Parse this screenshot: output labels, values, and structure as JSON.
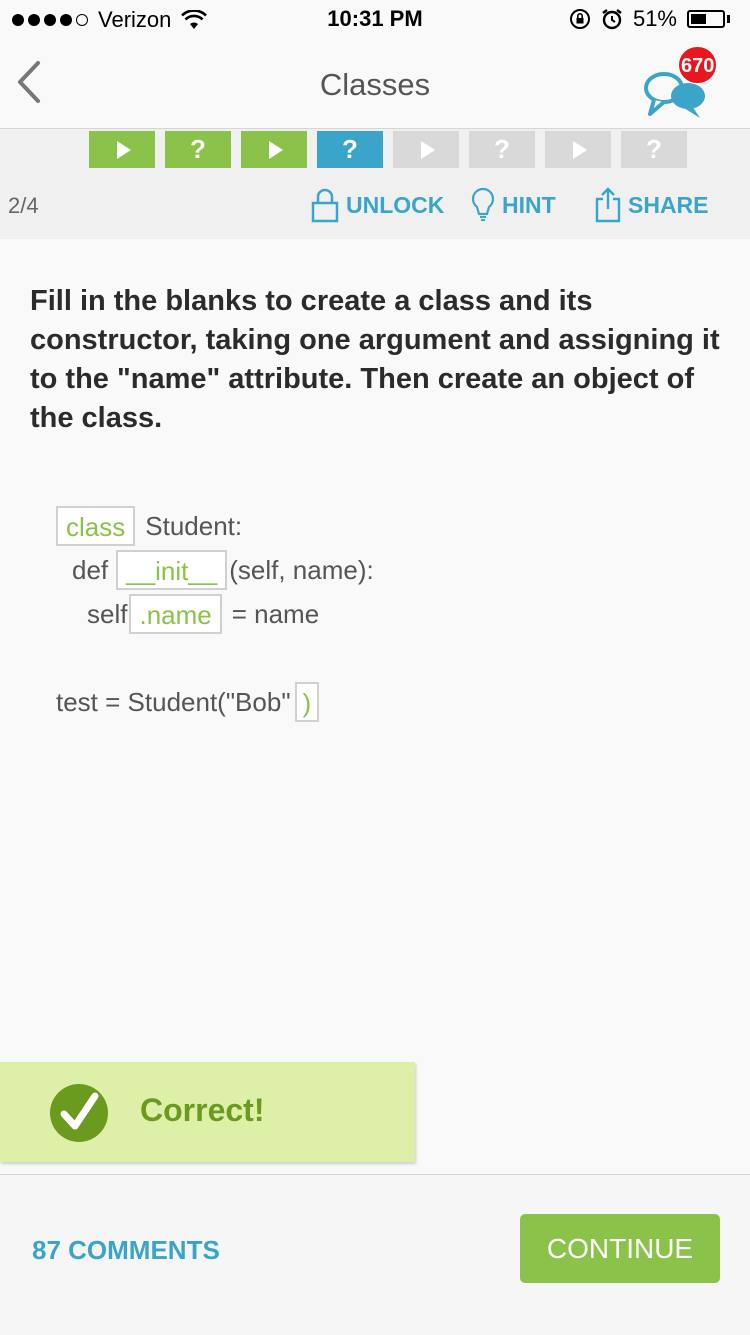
{
  "status_bar": {
    "carrier": "Verizon",
    "time": "10:31 PM",
    "battery": "51%",
    "battery_level": 0.51,
    "signal_bars_filled": 4,
    "signal_bars_total": 5
  },
  "header": {
    "title": "Classes",
    "chat_badge": "670"
  },
  "progress": {
    "steps": [
      {
        "kind": "play",
        "state": "done",
        "glyph": ""
      },
      {
        "kind": "quiz",
        "state": "done",
        "glyph": "?"
      },
      {
        "kind": "play",
        "state": "done",
        "glyph": ""
      },
      {
        "kind": "quiz",
        "state": "current",
        "glyph": "?"
      },
      {
        "kind": "play",
        "state": "future",
        "glyph": ""
      },
      {
        "kind": "quiz",
        "state": "future",
        "glyph": "?"
      },
      {
        "kind": "play",
        "state": "future",
        "glyph": ""
      },
      {
        "kind": "quiz",
        "state": "future",
        "glyph": "?"
      }
    ],
    "page_count": "2/4"
  },
  "actions": {
    "unlock": "UNLOCK",
    "hint": "HINT",
    "share": "SHARE"
  },
  "question": "Fill in the blanks to create a class and its constructor, taking one argument and assigning it to the \"name\" attribute. Then create an object of the class.",
  "code": {
    "line1": {
      "blank": "class",
      "text": "Student:"
    },
    "line2": {
      "prefix": "def",
      "blank": "__init__",
      "text": "(self, name):"
    },
    "line3": {
      "prefix": "self",
      "blank": ".name",
      "text": "= name"
    },
    "line4": {
      "prefix": "test = Student(\"Bob\"",
      "blank": ")"
    }
  },
  "result": {
    "text": "Correct!"
  },
  "footer": {
    "comments": "87 COMMENTS",
    "continue": "CONTINUE"
  },
  "colors": {
    "green": "#8bc34a",
    "blue": "#3aa5c8",
    "badge_red": "#e8161e",
    "correct_bg": "#def0a8"
  }
}
